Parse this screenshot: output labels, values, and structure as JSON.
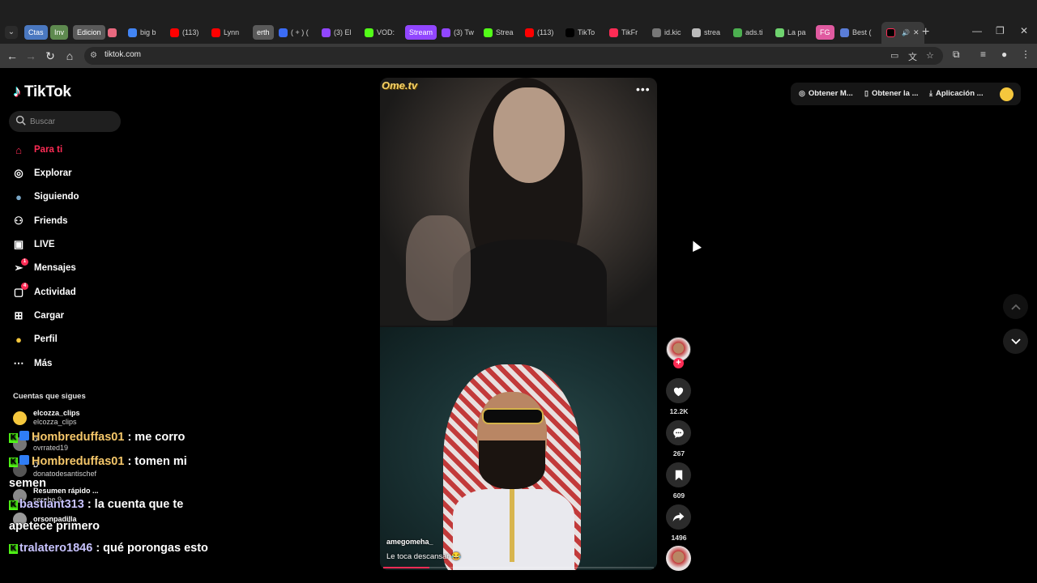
{
  "browser": {
    "tabs": [
      {
        "label": "Ctas",
        "kind": "pill",
        "color": "#4a78c0"
      },
      {
        "label": "Inv",
        "kind": "pill",
        "color": "#5e8a4f"
      },
      {
        "label": "Edicion",
        "kind": "pill",
        "color": "#5a5a5a"
      },
      {
        "label": "",
        "kind": "fav",
        "color": "#e8697f"
      },
      {
        "label": "big b",
        "kind": "fav",
        "color": "#4285f4"
      },
      {
        "label": "(113)",
        "kind": "fav",
        "color": "#ff0000"
      },
      {
        "label": "Lynn",
        "kind": "fav",
        "color": "#ff0000"
      },
      {
        "label": "erth",
        "kind": "pill",
        "color": "#5a5a5a"
      },
      {
        "label": "( + ) (",
        "kind": "fav",
        "color": "#3b6cf6"
      },
      {
        "label": "(3) El",
        "kind": "fav",
        "color": "#9146ff"
      },
      {
        "label": "VOD:",
        "kind": "fav",
        "color": "#53fc18"
      },
      {
        "label": "Stream",
        "kind": "pill",
        "color": "#9146ff"
      },
      {
        "label": "(3) Tw",
        "kind": "fav",
        "color": "#9146ff"
      },
      {
        "label": "Strea",
        "kind": "fav",
        "color": "#53fc18"
      },
      {
        "label": "(113)",
        "kind": "fav",
        "color": "#ff0000"
      },
      {
        "label": "TikTo",
        "kind": "fav",
        "color": "#000000"
      },
      {
        "label": "TikFr",
        "kind": "fav",
        "color": "#fe2c55"
      },
      {
        "label": "id.kic",
        "kind": "fav",
        "color": "#777777"
      },
      {
        "label": "strea",
        "kind": "fav",
        "color": "#bbbbbb"
      },
      {
        "label": "ads.ti",
        "kind": "fav",
        "color": "#4caf50"
      },
      {
        "label": "La pa",
        "kind": "fav",
        "color": "#6fd36f"
      },
      {
        "label": "FG",
        "kind": "pill",
        "color": "#e05aa0"
      },
      {
        "label": "Best (",
        "kind": "fav",
        "color": "#5a7dd8"
      },
      {
        "label": "",
        "kind": "active",
        "color": "#000000"
      }
    ],
    "url": "tiktok.com"
  },
  "sidebar": {
    "logo": "TikTok",
    "search_placeholder": "Buscar",
    "items": [
      {
        "label": "Para ti",
        "icon": "home-icon"
      },
      {
        "label": "Explorar",
        "icon": "compass-icon"
      },
      {
        "label": "Siguiendo",
        "icon": "following-avatar-icon"
      },
      {
        "label": "Friends",
        "icon": "friends-icon"
      },
      {
        "label": "LIVE",
        "icon": "live-icon"
      },
      {
        "label": "Mensajes",
        "icon": "messages-icon",
        "badge": "1"
      },
      {
        "label": "Actividad",
        "icon": "activity-icon",
        "badge": "4"
      },
      {
        "label": "Cargar",
        "icon": "upload-icon"
      },
      {
        "label": "Perfil",
        "icon": "profile-avatar-icon"
      },
      {
        "label": "Más",
        "icon": "more-icon"
      }
    ],
    "following_title": "Cuentas que sigues",
    "following": [
      {
        "name": "elcozza_clips",
        "handle": "elcozza_clips"
      },
      {
        "name": "o",
        "handle": "ovrrated19"
      },
      {
        "name": "D",
        "handle": "donatodesantischef"
      },
      {
        "name": "Resumen rápido ...",
        "handle": "serebe 9"
      },
      {
        "name": "orsonpadilla",
        "handle": ""
      }
    ]
  },
  "chat": [
    {
      "user": "Hombreduffas01",
      "message": ": me corro"
    },
    {
      "user": "Hombreduffas01",
      "message": ": tomen mi semen"
    },
    {
      "user": "bastiant313",
      "message": ": la cuenta que te apetece primero"
    },
    {
      "user": "tralatero1846",
      "message": ": qué porongas esto"
    }
  ],
  "video": {
    "watermark": "Ome.tv",
    "author": "amegomeha_",
    "caption": "Le toca descansar 😂",
    "progress": 0.17
  },
  "actions": {
    "likes": "12.2K",
    "comments": "267",
    "saves": "609",
    "shares": "1496"
  },
  "top_bar": {
    "btn1": "Obtener M...",
    "btn2": "Obtener la ...",
    "btn3": "Aplicación ..."
  }
}
